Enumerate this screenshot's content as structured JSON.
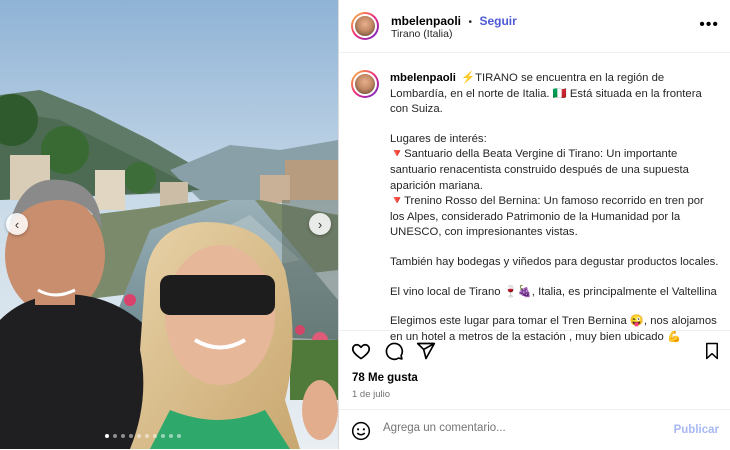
{
  "post": {
    "username": "mbelenpaoli",
    "follow_label": "Seguir",
    "location": "Tirano (Italia)",
    "more_label": "•••"
  },
  "caption": {
    "username": "mbelenpaoli",
    "line1": "⚡TIRANO se encuentra en la región de Lombardía, en el norte de Italia. 🇮🇹 Está situada en la frontera con Suiza.",
    "p2": "Lugares de interés:",
    "p3": "🔻Santuario della Beata Vergine di Tirano: Un importante santuario renacentista construido después de una supuesta aparición mariana.",
    "p4": "🔻Trenino Rosso del Bernina: Un famoso recorrido en tren por los Alpes, considerado Patrimonio de la Humanidad por la UNESCO, con impresionantes vistas.",
    "p5": "También hay bodegas y viñedos para degustar productos locales.",
    "p6": "El vino local de Tirano 🍷🍇, Italia, es principalmente el Valtellina",
    "p7": "Elegimos este lugar para tomar el Tren Bernina 😜, nos alojamos en un hotel a metros de la estación , muy bien ubicado 💪"
  },
  "stats": {
    "likes": "78 Me gusta",
    "date": "1 de julio"
  },
  "comment": {
    "placeholder": "Agrega un comentario...",
    "publish_label": "Publicar"
  },
  "carousel": {
    "prev": "‹",
    "next": "›",
    "total_slides": 10,
    "active_slide": 1
  },
  "icons": [
    "heart-icon",
    "comment-icon",
    "share-icon",
    "bookmark-icon",
    "emoji-icon",
    "chevron-left-icon",
    "chevron-right-icon"
  ]
}
